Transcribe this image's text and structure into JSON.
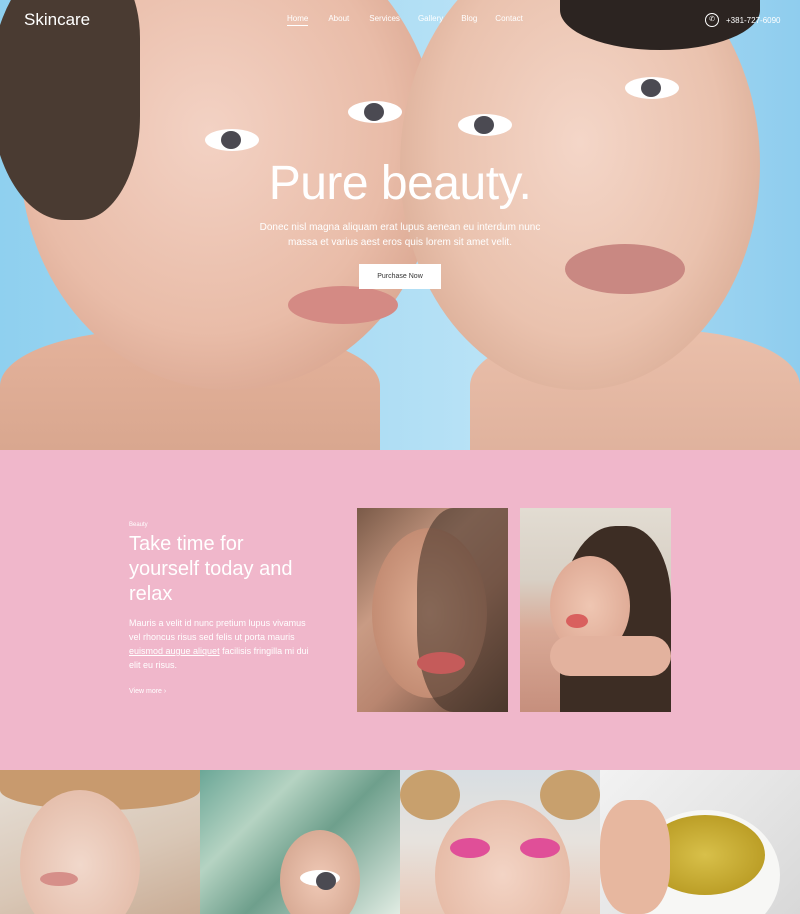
{
  "header": {
    "logo": "Skincare",
    "nav": [
      "Home",
      "About",
      "Services",
      "Gallery",
      "Blog",
      "Contact"
    ],
    "phone": "+381-727-6090"
  },
  "hero": {
    "title": "Pure beauty.",
    "text": "Donec nisl magna aliquam erat lupus aenean eu interdum nunc massa et varius aest eros quis lorem sit amet velit.",
    "button": "Purchase Now"
  },
  "about": {
    "tag": "Beauty",
    "heading": "Take time for yourself today and relax",
    "paragraph_before": "Mauris a velit id nunc pretium lupus vivamus vel rhoncus risus sed felis ut porta mauris ",
    "paragraph_link": "euismod augue aliquet",
    "paragraph_after": " facilisis fringilla mi dui elit eu risus.",
    "view_more": "View more"
  },
  "colors": {
    "pink_section": "#f0b7cb",
    "sky": "#a9dbf3"
  },
  "icons": {
    "phone": "phone-icon",
    "arrow": "arrow-right-icon"
  }
}
